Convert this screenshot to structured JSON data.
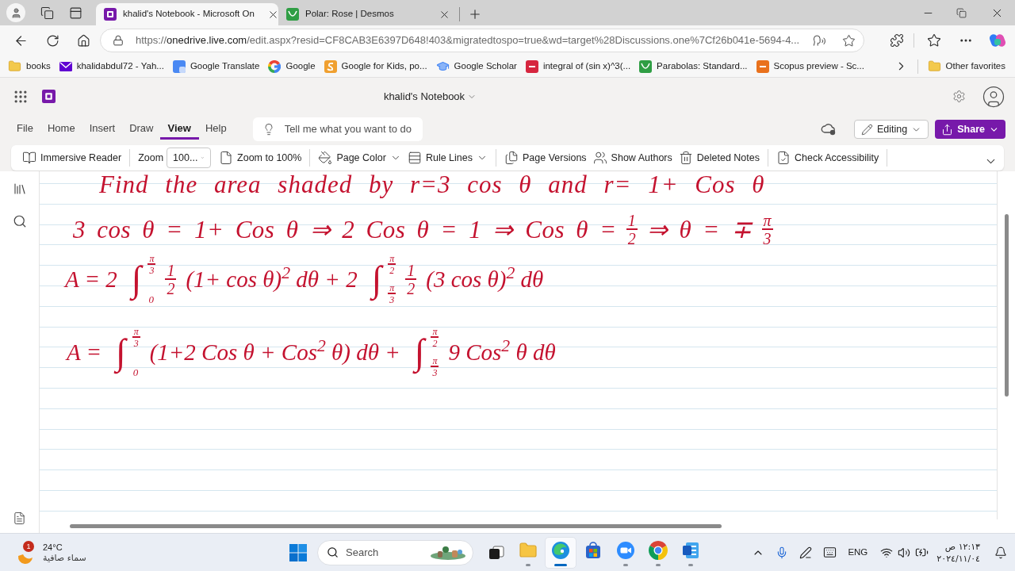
{
  "browser": {
    "tabs": [
      {
        "title": "khalid's Notebook - Microsoft On",
        "selected": true
      },
      {
        "title": "Polar: Rose | Desmos",
        "selected": false
      }
    ],
    "address": {
      "scheme": "https://",
      "host": "onedrive.live.com",
      "path": "/edit.aspx?resid=CF8CAB3E6397D648!403&migratedtospo=true&wd=target%28Discussions.one%7Cf26b041e-5694-4..."
    },
    "bookmarks": [
      "books",
      "khalidabdul72 - Yah...",
      "Google Translate",
      "Google",
      "Google for Kids, po...",
      "Google Scholar",
      "integral of (sin x)^3(...",
      "Parabolas: Standard...",
      "Scopus preview - Sc..."
    ],
    "other_favorites": "Other favorites"
  },
  "onenote": {
    "notebook_title": "khalid's Notebook",
    "ribbon_tabs": [
      {
        "label": "File",
        "selected": false
      },
      {
        "label": "Home",
        "selected": false
      },
      {
        "label": "Insert",
        "selected": false
      },
      {
        "label": "Draw",
        "selected": false
      },
      {
        "label": "View",
        "selected": true
      },
      {
        "label": "Help",
        "selected": false
      }
    ],
    "tell_me": {
      "placeholder": "Tell me what you want to do"
    },
    "editing": "Editing",
    "share": "Share",
    "toolbar_groups": [
      [
        {
          "kind": "button",
          "label": "Immersive Reader",
          "caret": false
        }
      ],
      [
        {
          "kind": "label",
          "label": "Zoom"
        },
        {
          "kind": "dropdown",
          "value": "100..."
        },
        {
          "kind": "button",
          "label": "Zoom to 100%",
          "caret": false
        }
      ],
      [
        {
          "kind": "button",
          "label": "Page Color",
          "caret": true
        },
        {
          "kind": "button",
          "label": "Rule Lines",
          "caret": true
        }
      ],
      [
        {
          "kind": "button",
          "label": "Page Versions",
          "caret": false
        },
        {
          "kind": "button",
          "label": "Show Authors",
          "caret": false
        },
        {
          "kind": "button",
          "label": "Deleted Notes",
          "caret": false
        }
      ],
      [
        {
          "kind": "button",
          "label": "Check Accessibility",
          "caret": false
        }
      ]
    ],
    "page": {
      "ink_lines": [
        {
          "parts": [
            {
              "kind": "text",
              "text": "Find the area shaded by r=3 cos θ and r= 1+ Cos θ"
            }
          ]
        },
        {
          "parts": [
            {
              "kind": "text",
              "text": "3 cos θ = 1+ Cos θ ⇒ 2 Cos θ = 1 ⇒ Cos θ ="
            },
            {
              "kind": "fraction",
              "num": "1",
              "den": "2"
            },
            {
              "kind": "text",
              "text": "⇒ θ = ∓"
            },
            {
              "kind": "fraction",
              "num": "π",
              "den": "3"
            }
          ]
        },
        {
          "parts": [
            {
              "kind": "text",
              "text": "A = 2"
            },
            {
              "kind": "integral",
              "symbol": "∫",
              "upper": {
                "num": "π",
                "den": "3"
              },
              "lower": {
                "text": "0"
              }
            },
            {
              "kind": "fraction",
              "num": "1",
              "den": "2"
            },
            {
              "kind": "text",
              "text": "(1+ cos θ)$^{2}$ dθ + 2"
            },
            {
              "kind": "integral",
              "symbol": "∫",
              "upper": {
                "num": "π",
                "den": "2"
              },
              "lower": {
                "num": "π",
                "den": "3"
              }
            },
            {
              "kind": "fraction",
              "num": "1",
              "den": "2"
            },
            {
              "kind": "text",
              "text": "(3 cos θ)$^{2}$ dθ"
            }
          ]
        },
        {
          "parts": [
            {
              "kind": "text",
              "text": "A ="
            },
            {
              "kind": "integral",
              "symbol": "∫",
              "upper": {
                "num": "π",
                "den": "3"
              },
              "lower": {
                "text": "0"
              }
            },
            {
              "kind": "text",
              "text": "(1+2 Cos θ + Cos$^{2}$ θ) dθ +"
            },
            {
              "kind": "integral",
              "symbol": "∫",
              "upper": {
                "num": "π",
                "den": "2"
              },
              "lower": {
                "num": "π",
                "den": "3"
              }
            },
            {
              "kind": "text",
              "text": "9 Cos$^{2}$ θ dθ"
            }
          ]
        }
      ]
    }
  },
  "taskbar": {
    "weather": {
      "badge": "1",
      "temperature": "24°C",
      "condition": "سماء صافية"
    },
    "search": {
      "placeholder": "Search"
    },
    "apps": [
      {
        "running": true,
        "selected": false
      },
      {
        "running": true,
        "selected": true
      },
      {
        "running": false,
        "selected": false
      },
      {
        "running": true,
        "selected": false
      },
      {
        "running": true,
        "selected": false
      },
      {
        "running": true,
        "selected": false
      }
    ],
    "language": "ENG",
    "time": "١٢:١٣ ص",
    "date": "٢٠٢٤/١١/٠٤"
  }
}
